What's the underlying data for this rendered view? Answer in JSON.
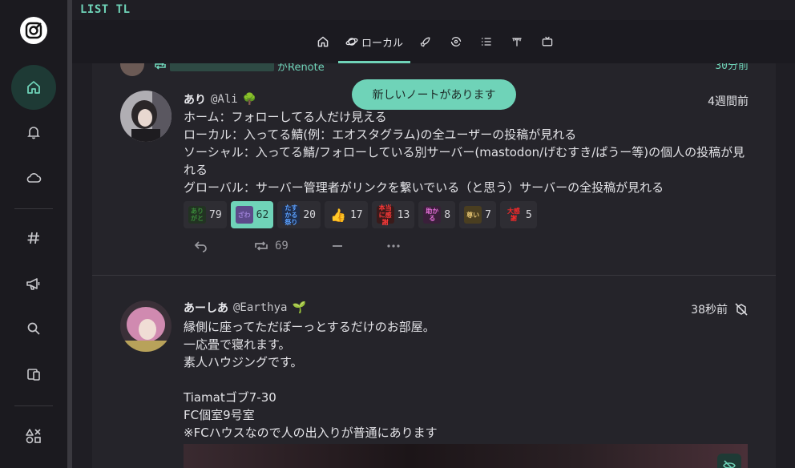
{
  "header": {
    "title": "LIST TL"
  },
  "nav": {
    "items": [
      {
        "name": "home",
        "icon": "home-icon",
        "active": true
      },
      {
        "name": "notifications",
        "icon": "bell-icon"
      },
      {
        "name": "drive",
        "icon": "cloud-icon"
      },
      {
        "name": "hashtags",
        "icon": "hashtag-icon"
      },
      {
        "name": "announcements",
        "icon": "megaphone-icon"
      },
      {
        "name": "search",
        "icon": "search-icon"
      },
      {
        "name": "pages",
        "icon": "device-icon"
      },
      {
        "name": "more",
        "icon": "shapes-icon"
      }
    ]
  },
  "tabs": [
    {
      "icon": "home-icon",
      "label": ""
    },
    {
      "icon": "planet-icon",
      "label": "ローカル",
      "active": true
    },
    {
      "icon": "rocket-icon",
      "label": ""
    },
    {
      "icon": "whirl-icon",
      "label": ""
    },
    {
      "icon": "list-icon",
      "label": ""
    },
    {
      "icon": "antenna-icon",
      "label": ""
    },
    {
      "icon": "tv-icon",
      "label": ""
    }
  ],
  "partial_note": {
    "text": "がRenote",
    "time": "30分前"
  },
  "new_notes_banner": "新しいノートがあります",
  "notes": [
    {
      "display_name": "あり",
      "username": "@Ali",
      "badge": "🌳",
      "time": "4週間前",
      "text": "ホーム：フォローしてる人だけ見える\nローカル：入ってる鯖(例：エオスタグラム)の全ユーザーの投稿が見れる\nソーシャル：入ってる鯖/フォローしている別サーバー(mastodon/げむすき/ぱうー等)の個人の投稿が見れる\nグローバル：サーバー管理者がリンクを繋いでいる（と思う）サーバーの全投稿が見れる",
      "reactions": [
        {
          "emoji": "ありがと",
          "count": "79",
          "color": "#3a8a3a",
          "bg": "#223322"
        },
        {
          "emoji": "ざわ",
          "count": "62",
          "color": "#9b7fd4",
          "bg": "#5c4a8a",
          "selected": true
        },
        {
          "emoji": "たすかる祭り",
          "count": "20",
          "color": "#5aa0ff",
          "bg": "#1f2d4a"
        },
        {
          "emoji": "👍",
          "count": "17",
          "color": "#f2c23a",
          "bg": "transparent"
        },
        {
          "emoji": "本当に感謝",
          "count": "13",
          "color": "#ff3a3a",
          "bg": "#3a1a1a"
        },
        {
          "emoji": "助かる",
          "count": "8",
          "color": "#e46fd8",
          "bg": "#3a1f3a"
        },
        {
          "emoji": "尊い",
          "count": "7",
          "color": "#e0c070",
          "bg": "#4a3e20"
        },
        {
          "emoji": "大感謝",
          "count": "5",
          "color": "#ff2a2a",
          "bg": "transparent"
        }
      ],
      "renote_count": "69"
    },
    {
      "display_name": "あーしあ",
      "username": "@Earthya",
      "badge": "🌱",
      "time": "38秒前",
      "text": "縁側に座ってただぼーっとするだけのお部屋。\n一応畳で寝れます。\n素人ハウジングです。\n\nTiamatゴブ7-30\nFC個室9号室\n※FCハウスなので人の出入りが普通にあります"
    }
  ],
  "colors": {
    "accent": "#6fd3b8",
    "panel": "#25242a",
    "nav": "#1b1a1f"
  }
}
